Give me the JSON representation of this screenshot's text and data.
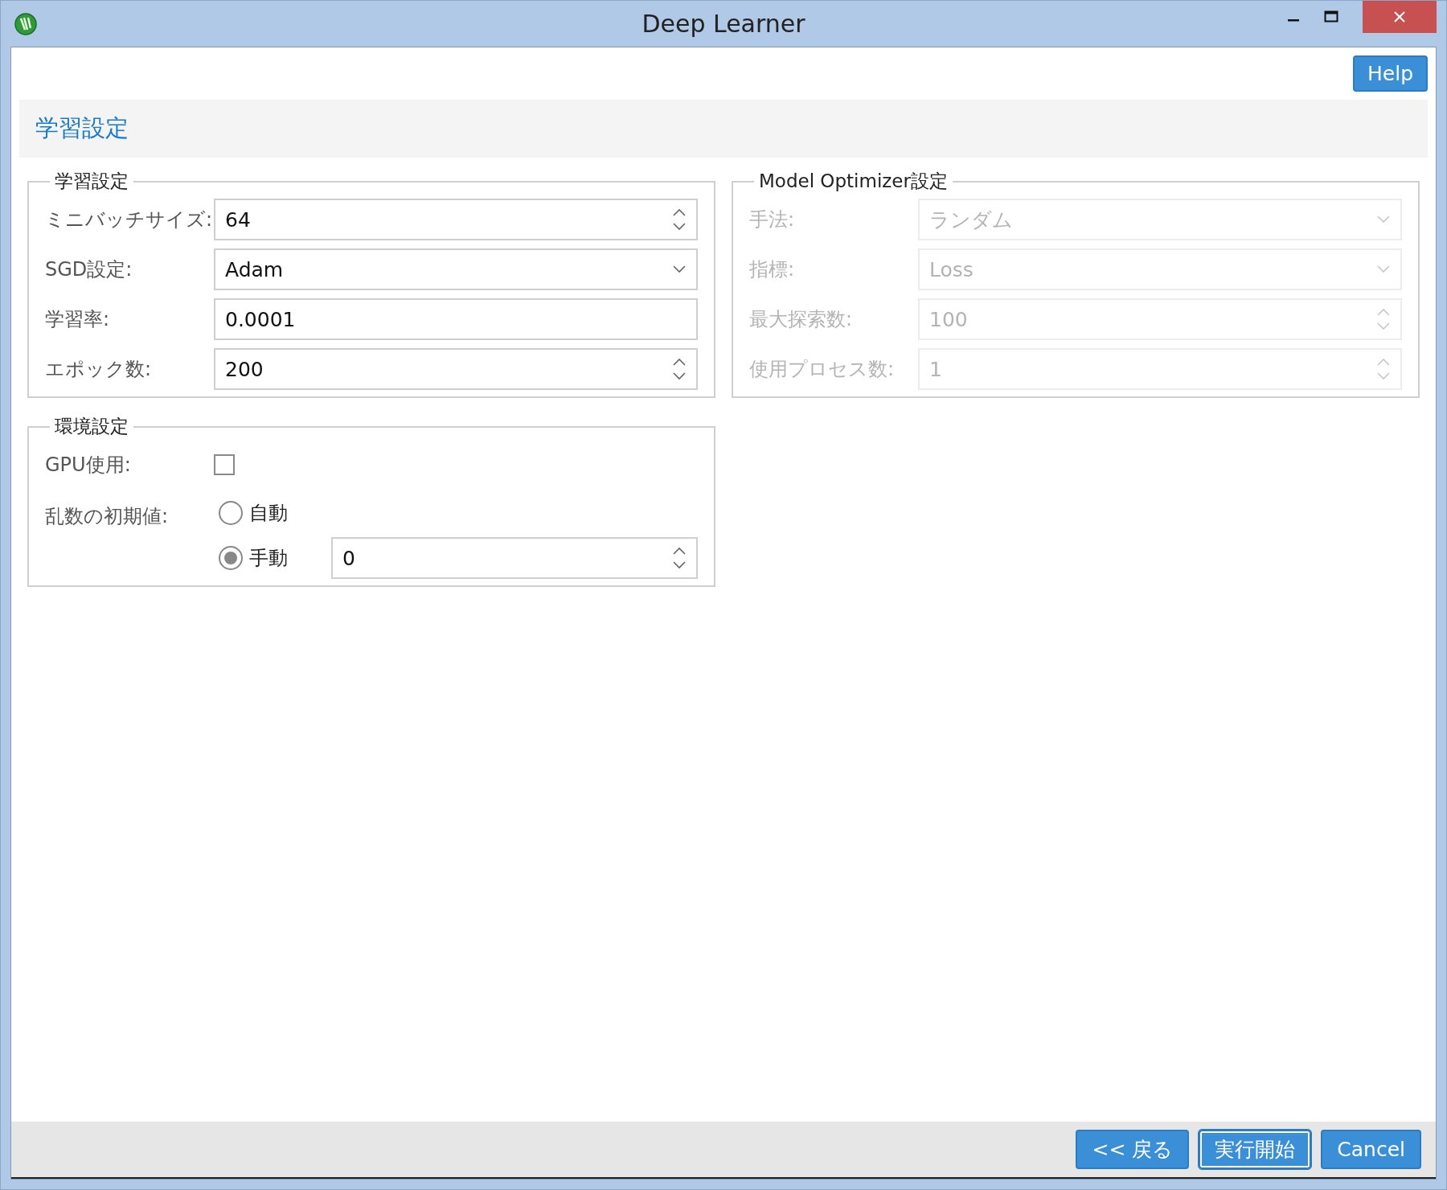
{
  "window": {
    "title": "Deep Learner"
  },
  "help_button": "Help",
  "page_title": "学習設定",
  "training_group": {
    "title": "学習設定",
    "disabled": false,
    "fields": [
      {
        "label": "ミニバッチサイズ:",
        "kind": "spin",
        "value": "64"
      },
      {
        "label": "SGD設定:",
        "kind": "combo",
        "value": "Adam"
      },
      {
        "label": "学習率:",
        "kind": "text",
        "value": "0.0001"
      },
      {
        "label": "エポック数:",
        "kind": "spin",
        "value": "200"
      }
    ]
  },
  "optimizer_group": {
    "title": "Model Optimizer設定",
    "disabled": true,
    "fields": [
      {
        "label": "手法:",
        "kind": "combo",
        "value": "ランダム"
      },
      {
        "label": "指標:",
        "kind": "combo",
        "value": "Loss"
      },
      {
        "label": "最大探索数:",
        "kind": "spin",
        "value": "100"
      },
      {
        "label": "使用プロセス数:",
        "kind": "spin",
        "value": "1"
      }
    ]
  },
  "environment_group": {
    "title": "環境設定",
    "gpu": {
      "label": "GPU使用:",
      "checked": false
    },
    "seed": {
      "label": "乱数の初期値:",
      "options": [
        {
          "label": "自動",
          "selected": false
        },
        {
          "label": "手動",
          "selected": true
        }
      ],
      "value": "0"
    }
  },
  "buttons": [
    {
      "label": "<< 戻る",
      "focused": false
    },
    {
      "label": "実行開始",
      "focused": true
    },
    {
      "label": "Cancel",
      "focused": false
    }
  ]
}
